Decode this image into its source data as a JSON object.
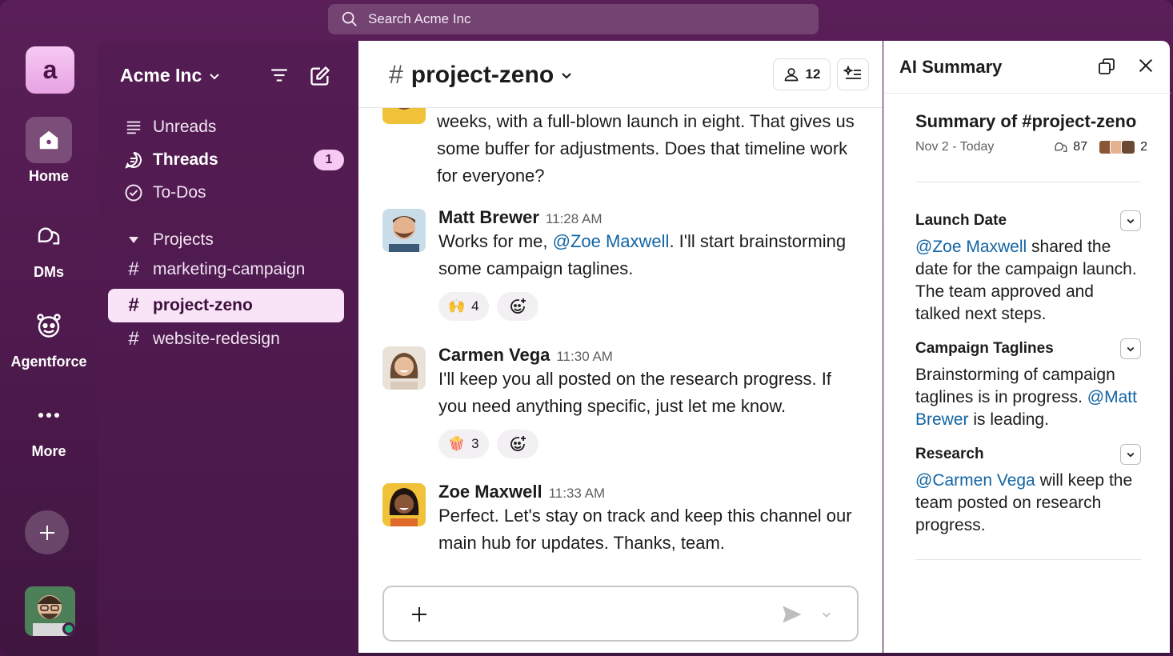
{
  "search": {
    "placeholder": "Search Acme Inc"
  },
  "rail": {
    "workspace_initial": "a",
    "items": [
      {
        "label": "Home",
        "icon": "home-icon"
      },
      {
        "label": "DMs",
        "icon": "dms-icon"
      },
      {
        "label": "Agentforce",
        "icon": "agentforce-icon"
      },
      {
        "label": "More",
        "icon": "more-icon"
      }
    ]
  },
  "sidebar": {
    "workspace_name": "Acme Inc",
    "items": [
      {
        "label": "Unreads",
        "icon": "unreads-icon"
      },
      {
        "label": "Threads",
        "icon": "threads-icon",
        "badge": "1"
      },
      {
        "label": "To-Dos",
        "icon": "todos-icon"
      }
    ],
    "section_label": "Projects",
    "channels": [
      {
        "name": "marketing-campaign"
      },
      {
        "name": "project-zeno",
        "active": true
      },
      {
        "name": "website-redesign"
      }
    ]
  },
  "channel": {
    "name": "project-zeno",
    "member_count": "12",
    "partial_message": "weeks, with a full-blown launch in eight. That gives us some buffer for adjustments. Does that timeline work for everyone?",
    "messages": [
      {
        "author": "Matt Brewer",
        "time": "11:28 AM",
        "text_before": "Works for me, ",
        "mention": "@Zoe Maxwell",
        "text_after": ". I'll start brainstorming some campaign taglines.",
        "reactions": [
          {
            "emoji": "🙌",
            "count": "4"
          }
        ]
      },
      {
        "author": "Carmen Vega",
        "time": "11:30 AM",
        "text": "I'll keep you all posted on the research progress. If you need anything specific, just let me know.",
        "reactions": [
          {
            "emoji": "🍿",
            "count": "3"
          }
        ]
      },
      {
        "author": "Zoe Maxwell",
        "time": "11:33 AM",
        "text": "Perfect. Let's stay on track and keep this channel our main hub for updates. Thanks, team."
      }
    ]
  },
  "ai_summary": {
    "panel_title": "AI Summary",
    "title": "Summary of #project-zeno",
    "date_range": "Nov 2 - Today",
    "thread_count": "87",
    "participant_count": "2",
    "sections": [
      {
        "heading": "Launch Date",
        "mention": "@Zoe Maxwell",
        "text": " shared the date for the campaign launch. The team approved and talked next steps."
      },
      {
        "heading": "Campaign Taglines",
        "text_before": "Brainstorming of campaign taglines is in progress. ",
        "mention": "@Matt Brewer",
        "text_after": " is leading."
      },
      {
        "heading": "Research",
        "mention": "@Carmen Vega",
        "text": " will keep the team posted on research progress."
      }
    ]
  },
  "colors": {
    "aubergine": "#4a154b",
    "mention": "#1264a3",
    "active_channel_bg": "#f9e3f7",
    "badge_bg": "#f6c9f3"
  }
}
